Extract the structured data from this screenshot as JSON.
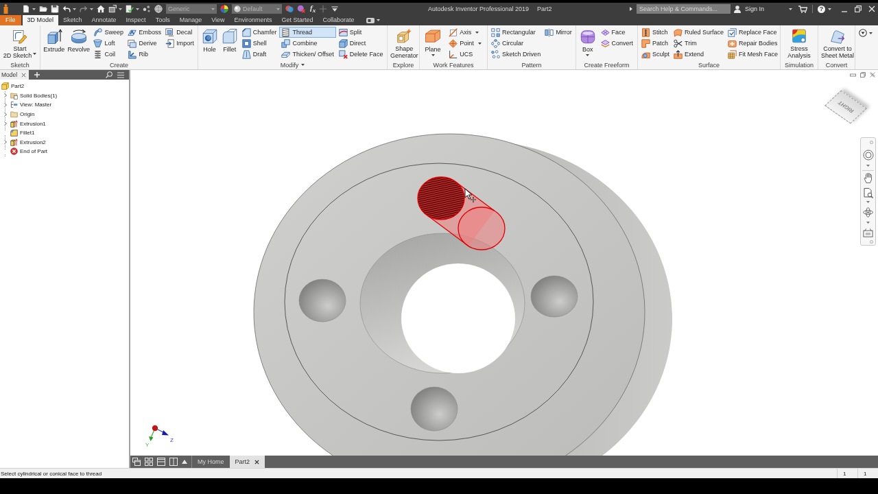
{
  "title_bar": {
    "quick_access": [
      {
        "kind": "tool",
        "dropdown": true,
        "disabled": false
      },
      {
        "kind": "tool",
        "disabled": false
      },
      {
        "kind": "tool",
        "disabled": false
      },
      {
        "kind": "tool",
        "dropdown": true,
        "disabled": false
      },
      {
        "kind": "tool",
        "dropdown": true,
        "disabled": true
      },
      {
        "kind": "tool",
        "disabled": false
      },
      {
        "kind": "tool",
        "dropdown": true,
        "disabled": false
      },
      {
        "kind": "tool",
        "dropdown": true,
        "disabled": false
      },
      {
        "kind": "tool",
        "disabled": false
      },
      {
        "kind": "tool",
        "disabled": false
      },
      {
        "kind": "select",
        "value": "Generic"
      },
      {
        "kind": "tool",
        "disabled": false
      },
      {
        "kind": "select",
        "value": "Default"
      },
      {
        "kind": "tool",
        "disabled": false
      },
      {
        "kind": "tool",
        "disabled": false
      },
      {
        "kind": "text",
        "label": "f$_{x}$"
      },
      {
        "kind": "tool",
        "disabled": true
      },
      {
        "kind": "tool",
        "disabled": false
      }
    ],
    "title": "Autodesk Inventor Professional 2019",
    "document": "Part2",
    "search": {
      "placeholder": "Search Help & Commands..."
    },
    "sign_in": "Sign In",
    "help": "?"
  },
  "ribbon": {
    "tabs": [
      {
        "label": "File",
        "kind": "application_menu",
        "selected": false
      },
      {
        "label": "3D Model",
        "kind": "tab",
        "selected": true
      },
      {
        "label": "Sketch",
        "kind": "tab",
        "selected": false
      },
      {
        "label": "Annotate",
        "kind": "tab",
        "selected": false
      },
      {
        "label": "Inspect",
        "kind": "tab",
        "selected": false
      },
      {
        "label": "Tools",
        "kind": "tab",
        "selected": false
      },
      {
        "label": "Manage",
        "kind": "tab",
        "selected": false
      },
      {
        "label": "View",
        "kind": "tab",
        "selected": false
      },
      {
        "label": "Environments",
        "kind": "tab",
        "selected": false
      },
      {
        "label": "Get Started",
        "kind": "tab",
        "selected": false
      },
      {
        "label": "Collaborate",
        "kind": "tab",
        "selected": false
      }
    ],
    "panels": [
      {
        "label": "Sketch",
        "tools": [
          {
            "kind": "large",
            "lines": [
              "Start",
              "2D Sketch"
            ],
            "dropdown": true,
            "selected": false
          }
        ]
      },
      {
        "label": "Create",
        "tools": [
          {
            "kind": "large",
            "lines": [
              "Extrude"
            ],
            "selected": false
          },
          {
            "kind": "large",
            "lines": [
              "Revolve"
            ],
            "selected": false
          },
          {
            "kind": "stack",
            "items": [
              {
                "label": "Sweep",
                "selected": false
              },
              {
                "label": "Loft",
                "selected": false
              },
              {
                "label": "Coil",
                "selected": false
              }
            ]
          },
          {
            "kind": "stack",
            "items": [
              {
                "label": "Emboss",
                "selected": false
              },
              {
                "label": "Derive",
                "selected": false
              },
              {
                "label": "Rib",
                "selected": false
              }
            ]
          },
          {
            "kind": "stack",
            "items": [
              {
                "label": "Decal",
                "selected": false
              },
              {
                "label": "Import",
                "selected": false
              }
            ]
          }
        ]
      },
      {
        "label": "Modify",
        "dropdown": true,
        "tools": [
          {
            "kind": "large",
            "lines": [
              "Hole"
            ],
            "selected": false
          },
          {
            "kind": "large",
            "lines": [
              "Fillet"
            ],
            "selected": false
          },
          {
            "kind": "stack",
            "items": [
              {
                "label": "Chamfer",
                "selected": false
              },
              {
                "label": "Shell",
                "selected": false
              },
              {
                "label": "Draft",
                "selected": false
              }
            ]
          },
          {
            "kind": "stack",
            "items": [
              {
                "label": "Thread",
                "selected": true
              },
              {
                "label": "Combine",
                "selected": false
              },
              {
                "label": "Thicken/ Offset",
                "selected": false
              }
            ]
          },
          {
            "kind": "stack",
            "items": [
              {
                "label": "Split",
                "selected": false
              },
              {
                "label": "Direct",
                "selected": false
              },
              {
                "label": "Delete Face",
                "selected": false
              }
            ]
          }
        ]
      },
      {
        "label": "Explore",
        "tools": [
          {
            "kind": "large",
            "lines": [
              "Shape",
              "Generator"
            ],
            "selected": false
          }
        ]
      },
      {
        "label": "Work Features",
        "tools": [
          {
            "kind": "large",
            "lines": [
              "Plane"
            ],
            "dropdown": true,
            "selected": false
          },
          {
            "kind": "stack",
            "items": [
              {
                "label": "Axis",
                "dropdown": true,
                "selected": false
              },
              {
                "label": "Point",
                "dropdown": true,
                "selected": false
              },
              {
                "label": "UCS",
                "selected": false
              }
            ]
          }
        ]
      },
      {
        "label": "Pattern",
        "tools": [
          {
            "kind": "stack",
            "items": [
              {
                "label": "Rectangular",
                "selected": false
              },
              {
                "label": "Circular",
                "selected": false
              },
              {
                "label": "Sketch Driven",
                "selected": false
              }
            ]
          },
          {
            "kind": "stack",
            "items": [
              {
                "label": "Mirror",
                "selected": false
              }
            ]
          }
        ]
      },
      {
        "label": "Create Freeform",
        "tools": [
          {
            "kind": "large",
            "lines": [
              "Box"
            ],
            "dropdown": true,
            "selected": false
          },
          {
            "kind": "stack",
            "items": [
              {
                "label": "Face",
                "selected": false
              },
              {
                "label": "Convert",
                "selected": false
              }
            ]
          }
        ]
      },
      {
        "label": "Surface",
        "tools": [
          {
            "kind": "stack",
            "items": [
              {
                "label": "Stitch",
                "selected": false
              },
              {
                "label": "Patch",
                "selected": false
              },
              {
                "label": "Sculpt",
                "selected": false
              }
            ]
          },
          {
            "kind": "stack",
            "items": [
              {
                "label": "Ruled Surface",
                "selected": false
              },
              {
                "label": "Trim",
                "selected": false
              },
              {
                "label": "Extend",
                "selected": false
              }
            ]
          },
          {
            "kind": "stack",
            "items": [
              {
                "label": "Replace Face",
                "selected": false
              },
              {
                "label": "Repair Bodies",
                "selected": false
              },
              {
                "label": "Fit Mesh Face",
                "selected": false
              }
            ]
          }
        ]
      },
      {
        "label": "Simulation",
        "tools": [
          {
            "kind": "large",
            "lines": [
              "Stress",
              "Analysis"
            ],
            "selected": false
          }
        ]
      },
      {
        "label": "Convert",
        "tools": [
          {
            "kind": "large",
            "lines": [
              "Convert to",
              "Sheet Metal"
            ],
            "selected": false
          }
        ]
      }
    ]
  },
  "browser": {
    "tab": "Model",
    "tree": {
      "label": "Part2",
      "children": [
        {
          "label": "Solid Bodies(1)",
          "expandable": true,
          "expanded": false
        },
        {
          "label": "View: Master",
          "expandable": true,
          "expanded": false
        },
        {
          "label": "Origin",
          "expandable": true,
          "expanded": false
        },
        {
          "label": "Extrusion1",
          "expandable": true,
          "expanded": false
        },
        {
          "label": "Fillet1",
          "expandable": false
        },
        {
          "label": "Extrusion2",
          "expandable": true,
          "expanded": false
        },
        {
          "label": "End of Part",
          "expandable": false
        }
      ]
    }
  },
  "viewport": {
    "view_cube": {
      "face": "RIGHT"
    },
    "axis_labels": [
      "Y",
      "Z"
    ]
  },
  "document_tabs": [
    {
      "label": "My Home",
      "selected": false
    },
    {
      "label": "Part2",
      "selected": true
    }
  ],
  "status_bar": {
    "prompt": "Select cylindrical or conical face to thread",
    "cells": [
      "1",
      "1"
    ]
  }
}
